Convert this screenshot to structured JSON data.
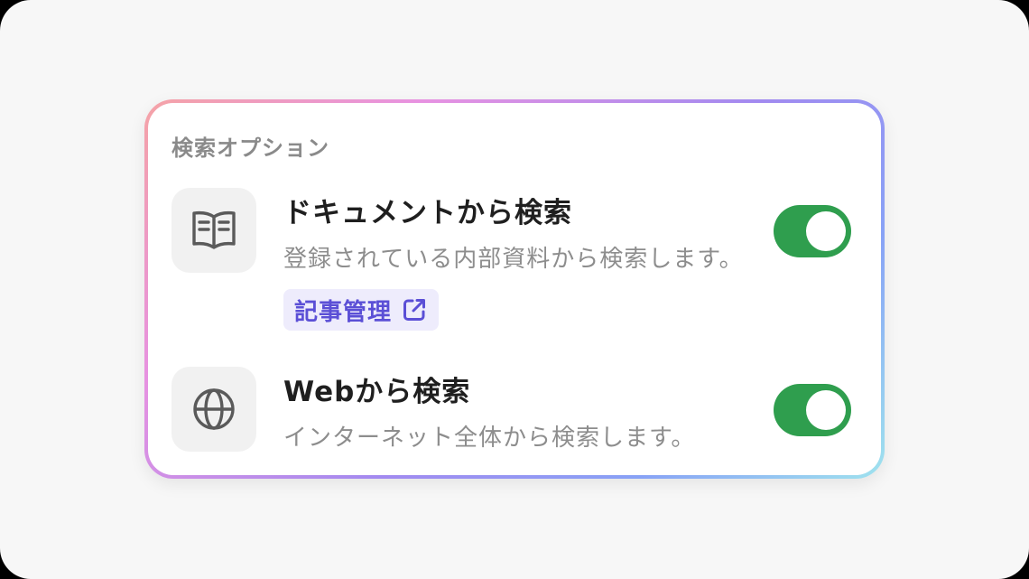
{
  "panel": {
    "title": "検索オプション"
  },
  "options": [
    {
      "icon": "book-icon",
      "title": "ドキュメントから検索",
      "description": "登録されている内部資料から検索します。",
      "link_label": "記事管理",
      "link_icon": "external-link-icon",
      "enabled": true
    },
    {
      "icon": "globe-icon",
      "title": "Webから検索",
      "description": "インターネット全体から検索します。",
      "enabled": true
    }
  ],
  "colors": {
    "toggle_on": "#2f9e4e",
    "link_text": "#5b4fd6",
    "link_bg": "#eeecfc",
    "border_gradient": [
      "#f5a3a6",
      "#e792e1",
      "#a28af0",
      "#88a2f6",
      "#9fe3ee"
    ]
  }
}
